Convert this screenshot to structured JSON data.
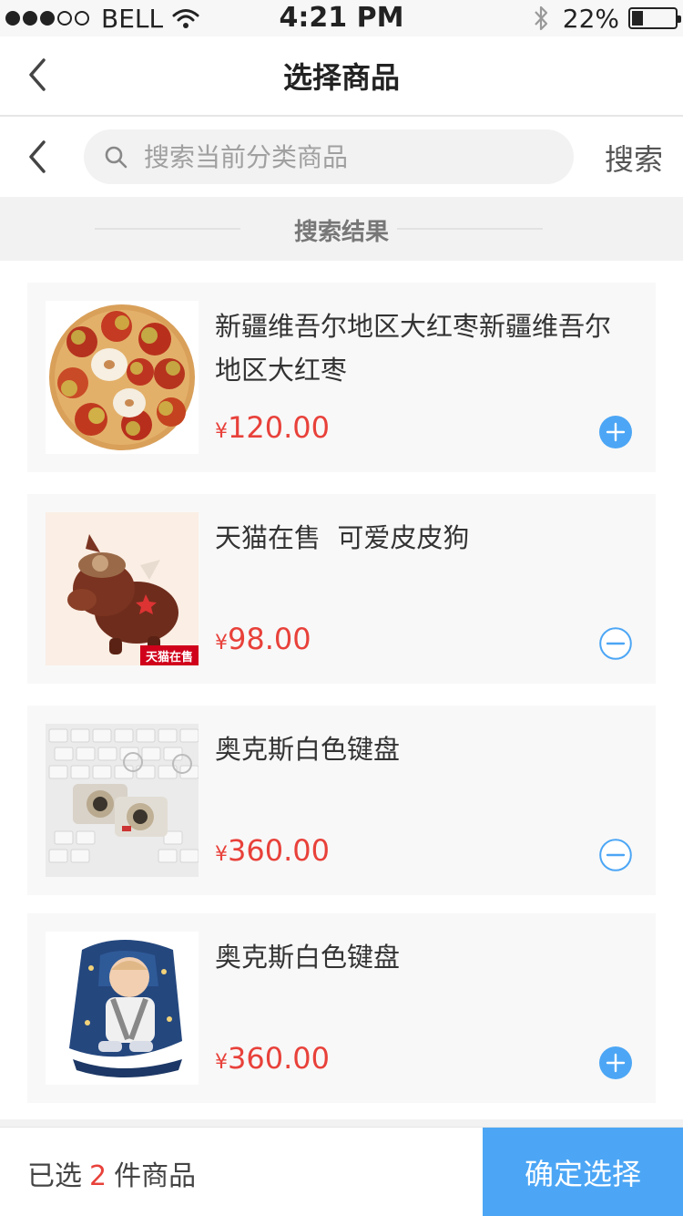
{
  "status_bar": {
    "carrier": "BELL",
    "time": "4:21 PM",
    "battery_percent": "22%",
    "signal_bars": 3,
    "signal_total": 5,
    "battery_level": 0.22
  },
  "nav": {
    "title": "选择商品"
  },
  "search": {
    "placeholder": "搜索当前分类商品",
    "button_label": "搜索"
  },
  "results_header": "搜索结果",
  "products": [
    {
      "name": "新疆维吾尔地区大红枣新疆维吾尔地区大红枣",
      "currency": "¥",
      "price": "120.00",
      "selected": false,
      "image": "red-dates-image"
    },
    {
      "name": "天猫在售  可爱皮皮狗",
      "currency": "¥",
      "price": "98.00",
      "selected": true,
      "image": "plush-toy-image",
      "image_badge": "天猫在售"
    },
    {
      "name": "奥克斯白色键盘",
      "currency": "¥",
      "price": "360.00",
      "selected": true,
      "image": "camera-keychain-image"
    },
    {
      "name": "奥克斯白色键盘",
      "currency": "¥",
      "price": "360.00",
      "selected": false,
      "image": "baby-car-seat-image"
    }
  ],
  "bottom": {
    "prefix": "已选",
    "count": "2",
    "suffix": "件商品",
    "confirm_label": "确定选择"
  },
  "colors": {
    "accent_blue": "#4ca6f5",
    "price_red": "#e8413a"
  }
}
